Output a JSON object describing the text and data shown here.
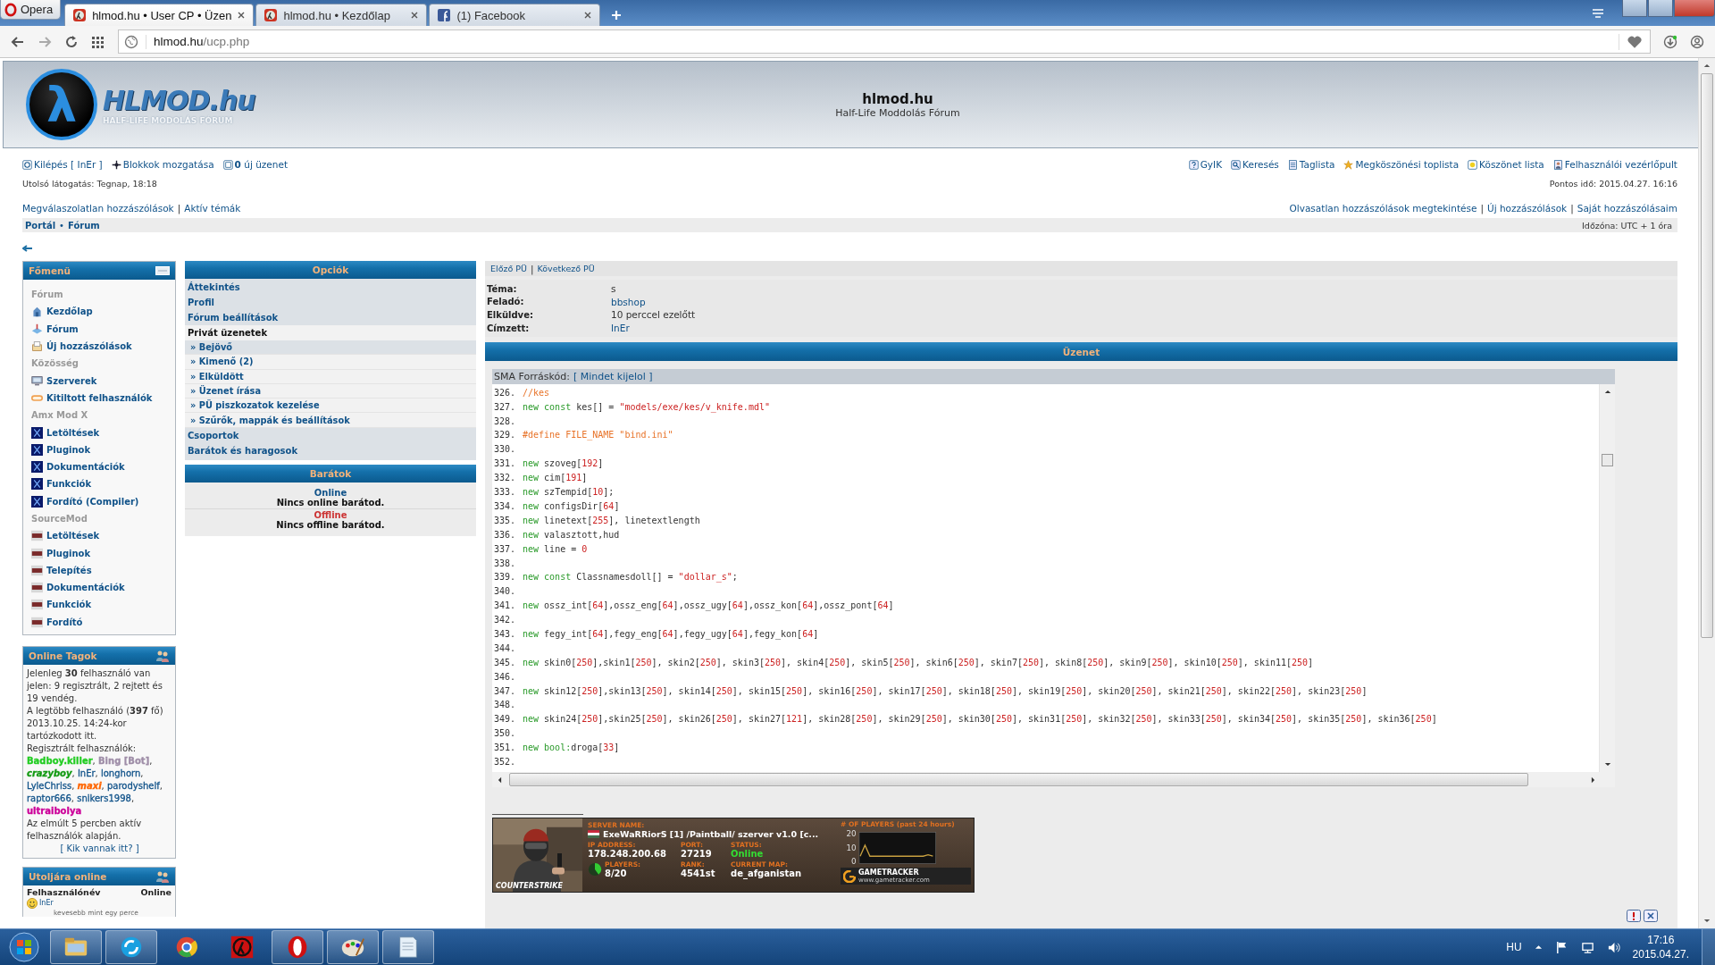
{
  "browser": {
    "opera_label": "Opera",
    "url_host": "hlmod.hu",
    "url_path": "/ucp.php",
    "tabs": [
      {
        "kind": "site",
        "title": "hlmod.hu • User CP • Üzen",
        "selected": true
      },
      {
        "kind": "site",
        "title": "hlmod.hu • Kezdőlap",
        "selected": false
      },
      {
        "kind": "social",
        "title": "(1) Facebook",
        "selected": false
      }
    ]
  },
  "header": {
    "logo_symbol": "λ",
    "logo_name": "HLMOD.hu",
    "logo_tagline": "HALF-LIFE MODOLÁS FÓRUM",
    "title": "hlmod.hu",
    "subtitle": "Half-Life Moddolás Fórum"
  },
  "nav": {
    "left": [
      {
        "kind": "power",
        "text": "Kilépés [ InEr ]"
      },
      {
        "kind": "move",
        "text": "Blokkok mozgatása"
      },
      {
        "kind": "mail",
        "text": "**0** új üzenet"
      }
    ],
    "right": [
      {
        "kind": "help",
        "text": "GyIK"
      },
      {
        "kind": "search",
        "text": "Keresés"
      },
      {
        "kind": "list",
        "text": "Taglista"
      },
      {
        "kind": "star",
        "text": "Megköszönési toplista"
      },
      {
        "kind": "medal",
        "text": "Köszönet lista"
      },
      {
        "kind": "user",
        "text": "Felhasználói vezérlőpult"
      }
    ],
    "last_visit": "Utolsó látogatás: Tegnap, 18:18",
    "current_time": "Pontos idő: 2015.04.27. 16:16",
    "separator": "|",
    "quick_left": [
      "Megválaszolatlan hozzászólások",
      "Aktív témák"
    ],
    "quick_right": [
      "Olvasatlan hozzászólások megtekintése",
      "Új hozzászólások",
      "Saját hozzászólásaim"
    ]
  },
  "breadcrumb": {
    "items": [
      "Portál",
      "Fórum"
    ],
    "separator": "•",
    "timezone": "Időzóna: UTC + 1 óra"
  },
  "main_menu": {
    "title": "Főmenü",
    "items": [
      {
        "kind": "heading",
        "text": "Fórum"
      },
      {
        "kind": "home",
        "text": "Kezdőlap"
      },
      {
        "kind": "forum",
        "text": "Fórum"
      },
      {
        "kind": "posts",
        "text": "Új hozzászólások"
      },
      {
        "kind": "heading",
        "text": "Közösség"
      },
      {
        "kind": "monitor",
        "text": "Szerverek"
      },
      {
        "kind": "newbadge",
        "text": "Kitiltott felhasználók"
      },
      {
        "kind": "heading",
        "text": "Amx Mod X"
      },
      {
        "kind": "amxx",
        "text": "Letöltések"
      },
      {
        "kind": "amxx",
        "text": "Pluginok"
      },
      {
        "kind": "amxx",
        "text": "Dokumentációk"
      },
      {
        "kind": "amxx",
        "text": "Funkciók"
      },
      {
        "kind": "amxx",
        "text": "Fordító (Compiler)"
      },
      {
        "kind": "heading",
        "text": "SourceMod"
      },
      {
        "kind": "sm",
        "text": "Letöltések"
      },
      {
        "kind": "sm",
        "text": "Pluginok"
      },
      {
        "kind": "sm",
        "text": "Telepítés"
      },
      {
        "kind": "sm",
        "text": "Dokumentációk"
      },
      {
        "kind": "sm",
        "text": "Funkciók"
      },
      {
        "kind": "sm",
        "text": "Fordító"
      }
    ]
  },
  "online_members": {
    "title": "Online Tagok",
    "summary": "Jelenleg **30** felhasználó van jelen: 9 regisztrált, 2 rejtett és 19 vendég.",
    "record": "A legtöbb felhasználó (**397** fő) 2013.10.25. 14:24-kor tartózkodott itt.",
    "registered_label": "Regisztrált felhasználók:",
    "users": [
      {
        "name": "Badboy.killer",
        "kind": "bold",
        "color": "#22cc22",
        "sep": ","
      },
      {
        "name": "Bing [Bot]",
        "kind": "bold",
        "color": "#9e8da7",
        "sep": ","
      },
      {
        "name": "crazyboy",
        "kind": "bolditalic",
        "color": "#119911",
        "sep": ","
      },
      {
        "name": "InEr",
        "kind": "plain",
        "color": "#105289",
        "sep": ","
      },
      {
        "name": "longhorn",
        "kind": "plain",
        "color": "#105289",
        "sep": ","
      },
      {
        "name": "LyleChriss",
        "kind": "plain",
        "color": "#105289",
        "sep": ","
      },
      {
        "name": "maxi",
        "kind": "bolditalic",
        "color": "#ff6600",
        "sep": ","
      },
      {
        "name": "parodyshelf",
        "kind": "plain",
        "color": "#105289",
        "sep": ","
      },
      {
        "name": "raptor666",
        "kind": "plain",
        "color": "#105289",
        "sep": ","
      },
      {
        "name": "snikers1998",
        "kind": "plain",
        "color": "#105289",
        "sep": ","
      },
      {
        "name": "ultraibolya",
        "kind": "bold",
        "color": "#cc0099"
      }
    ],
    "footer": "Az elmúlt 5 percben aktív felhasználók alapján.",
    "link": "[ Kik vannak itt? ]"
  },
  "last_online": {
    "title": "Utoljára online",
    "col_name": "Felhasználónév",
    "col_time": "Online",
    "rows": [
      {
        "name": "InEr",
        "time": "kevesebb mint egy perce"
      }
    ]
  },
  "options": {
    "title": "Opciók",
    "bullet": "»",
    "items": [
      {
        "kind": "link",
        "text": "Áttekintés",
        "selected": false
      },
      {
        "kind": "link",
        "text": "Profil",
        "selected": false
      },
      {
        "kind": "link",
        "text": "Fórum beállítások",
        "selected": false
      },
      {
        "kind": "group",
        "text": "Privát üzenetek",
        "selected": false
      },
      {
        "kind": "sub",
        "text": "Bejövő",
        "selected": true
      },
      {
        "kind": "sub",
        "text": "Kimenő (2)",
        "selected": false
      },
      {
        "kind": "sub",
        "text": "Elküldött",
        "selected": false
      },
      {
        "kind": "sub",
        "text": "Üzenet írása",
        "selected": false
      },
      {
        "kind": "sub",
        "text": "PÜ piszkozatok kezelése",
        "selected": false
      },
      {
        "kind": "sub",
        "text": "Szűrők, mappák és beállítások",
        "selected": false
      },
      {
        "kind": "link",
        "text": "Csoportok",
        "selected": false
      },
      {
        "kind": "link",
        "text": "Barátok és haragosok",
        "selected": false
      }
    ]
  },
  "friends": {
    "title": "Barátok",
    "groups": [
      {
        "label": "Online",
        "color": "#105289",
        "text": "Nincs online barátod."
      },
      {
        "label": "Offline",
        "color": "#cc3333",
        "text": "Nincs offline barátod."
      }
    ]
  },
  "message": {
    "prev": "Előző PÜ",
    "separator": "|",
    "next": "Következő PÜ",
    "section_title": "Üzenet",
    "fields": [
      {
        "kind": "text",
        "label": "Téma:",
        "value": "s"
      },
      {
        "kind": "link",
        "label": "Feladó:",
        "value": "bbshop"
      },
      {
        "kind": "text",
        "label": "Elküldve:",
        "value": "10 perccel ezelőtt"
      },
      {
        "kind": "link",
        "label": "Címzett:",
        "value": "InEr"
      }
    ]
  },
  "code": {
    "title": "SMA Forráskód:",
    "select_all": "[ Mindet kijelol ]",
    "lines": [
      {
        "number": "326.",
        "tokens": [
          {
            "kind": "c",
            "text": "//kes"
          }
        ]
      },
      {
        "number": "327.",
        "tokens": [
          {
            "kind": "k",
            "text": "new const "
          },
          {
            "kind": "i",
            "text": "kes[] = "
          },
          {
            "kind": "s",
            "text": "\"models/exe/kes/v_knife.mdl\""
          }
        ]
      },
      {
        "number": "328."
      },
      {
        "number": "329.",
        "tokens": [
          {
            "kind": "c",
            "text": "#define FILE_NAME \"bind.ini\""
          }
        ]
      },
      {
        "number": "330."
      },
      {
        "number": "331.",
        "tokens": [
          {
            "kind": "k",
            "text": "new "
          },
          {
            "kind": "i",
            "text": "szoveg["
          },
          {
            "kind": "n",
            "text": "192"
          },
          {
            "kind": "i",
            "text": "]"
          }
        ]
      },
      {
        "number": "332.",
        "tokens": [
          {
            "kind": "k",
            "text": "new "
          },
          {
            "kind": "i",
            "text": "cim["
          },
          {
            "kind": "n",
            "text": "191"
          },
          {
            "kind": "i",
            "text": "]"
          }
        ]
      },
      {
        "number": "333.",
        "tokens": [
          {
            "kind": "k",
            "text": "new "
          },
          {
            "kind": "i",
            "text": "szTempid["
          },
          {
            "kind": "n",
            "text": "10"
          },
          {
            "kind": "i",
            "text": "];"
          }
        ]
      },
      {
        "number": "334.",
        "tokens": [
          {
            "kind": "k",
            "text": "new "
          },
          {
            "kind": "i",
            "text": "configsDir["
          },
          {
            "kind": "n",
            "text": "64"
          },
          {
            "kind": "i",
            "text": "]"
          }
        ]
      },
      {
        "number": "335.",
        "tokens": [
          {
            "kind": "k",
            "text": "new "
          },
          {
            "kind": "i",
            "text": "linetext["
          },
          {
            "kind": "n",
            "text": "255"
          },
          {
            "kind": "i",
            "text": "], linetextlength"
          }
        ]
      },
      {
        "number": "336.",
        "tokens": [
          {
            "kind": "k",
            "text": "new "
          },
          {
            "kind": "i",
            "text": "valasztott,hud"
          }
        ]
      },
      {
        "number": "337.",
        "tokens": [
          {
            "kind": "k",
            "text": "new "
          },
          {
            "kind": "i",
            "text": "line = "
          },
          {
            "kind": "n",
            "text": "0"
          }
        ]
      },
      {
        "number": "338."
      },
      {
        "number": "339.",
        "tokens": [
          {
            "kind": "k",
            "text": "new const "
          },
          {
            "kind": "i",
            "text": "Classnamesdoll[] = "
          },
          {
            "kind": "s",
            "text": "\"dollar_s\""
          },
          {
            "kind": "i",
            "text": ";"
          }
        ]
      },
      {
        "number": "340."
      },
      {
        "number": "341.",
        "tokens": [
          {
            "kind": "k",
            "text": "new "
          },
          {
            "kind": "i",
            "text": "ossz_int["
          },
          {
            "kind": "n",
            "text": "64"
          },
          {
            "kind": "i",
            "text": "],ossz_eng["
          },
          {
            "kind": "n",
            "text": "64"
          },
          {
            "kind": "i",
            "text": "],ossz_ugy["
          },
          {
            "kind": "n",
            "text": "64"
          },
          {
            "kind": "i",
            "text": "],ossz_kon["
          },
          {
            "kind": "n",
            "text": "64"
          },
          {
            "kind": "i",
            "text": "],ossz_pont["
          },
          {
            "kind": "n",
            "text": "64"
          },
          {
            "kind": "i",
            "text": "]"
          }
        ]
      },
      {
        "number": "342."
      },
      {
        "number": "343.",
        "tokens": [
          {
            "kind": "k",
            "text": "new "
          },
          {
            "kind": "i",
            "text": "fegy_int["
          },
          {
            "kind": "n",
            "text": "64"
          },
          {
            "kind": "i",
            "text": "],fegy_eng["
          },
          {
            "kind": "n",
            "text": "64"
          },
          {
            "kind": "i",
            "text": "],fegy_ugy["
          },
          {
            "kind": "n",
            "text": "64"
          },
          {
            "kind": "i",
            "text": "],fegy_kon["
          },
          {
            "kind": "n",
            "text": "64"
          },
          {
            "kind": "i",
            "text": "]"
          }
        ]
      },
      {
        "number": "344."
      },
      {
        "number": "345.",
        "tokens": [
          {
            "kind": "k",
            "text": "new "
          },
          {
            "kind": "i",
            "text": "skin0["
          },
          {
            "kind": "n",
            "text": "250"
          },
          {
            "kind": "i",
            "text": "],skin1["
          },
          {
            "kind": "n",
            "text": "250"
          },
          {
            "kind": "i",
            "text": "], skin2["
          },
          {
            "kind": "n",
            "text": "250"
          },
          {
            "kind": "i",
            "text": "], skin3["
          },
          {
            "kind": "n",
            "text": "250"
          },
          {
            "kind": "i",
            "text": "], skin4["
          },
          {
            "kind": "n",
            "text": "250"
          },
          {
            "kind": "i",
            "text": "], skin5["
          },
          {
            "kind": "n",
            "text": "250"
          },
          {
            "kind": "i",
            "text": "], skin6["
          },
          {
            "kind": "n",
            "text": "250"
          },
          {
            "kind": "i",
            "text": "], skin7["
          },
          {
            "kind": "n",
            "text": "250"
          },
          {
            "kind": "i",
            "text": "], skin8["
          },
          {
            "kind": "n",
            "text": "250"
          },
          {
            "kind": "i",
            "text": "], skin9["
          },
          {
            "kind": "n",
            "text": "250"
          },
          {
            "kind": "i",
            "text": "], skin10["
          },
          {
            "kind": "n",
            "text": "250"
          },
          {
            "kind": "i",
            "text": "], skin11["
          },
          {
            "kind": "n",
            "text": "250"
          },
          {
            "kind": "i",
            "text": "]"
          }
        ]
      },
      {
        "number": "346."
      },
      {
        "number": "347.",
        "tokens": [
          {
            "kind": "k",
            "text": "new "
          },
          {
            "kind": "i",
            "text": "skin12["
          },
          {
            "kind": "n",
            "text": "250"
          },
          {
            "kind": "i",
            "text": "],skin13["
          },
          {
            "kind": "n",
            "text": "250"
          },
          {
            "kind": "i",
            "text": "], skin14["
          },
          {
            "kind": "n",
            "text": "250"
          },
          {
            "kind": "i",
            "text": "], skin15["
          },
          {
            "kind": "n",
            "text": "250"
          },
          {
            "kind": "i",
            "text": "], skin16["
          },
          {
            "kind": "n",
            "text": "250"
          },
          {
            "kind": "i",
            "text": "], skin17["
          },
          {
            "kind": "n",
            "text": "250"
          },
          {
            "kind": "i",
            "text": "], skin18["
          },
          {
            "kind": "n",
            "text": "250"
          },
          {
            "kind": "i",
            "text": "], skin19["
          },
          {
            "kind": "n",
            "text": "250"
          },
          {
            "kind": "i",
            "text": "], skin20["
          },
          {
            "kind": "n",
            "text": "250"
          },
          {
            "kind": "i",
            "text": "], skin21["
          },
          {
            "kind": "n",
            "text": "250"
          },
          {
            "kind": "i",
            "text": "], skin22["
          },
          {
            "kind": "n",
            "text": "250"
          },
          {
            "kind": "i",
            "text": "], skin23["
          },
          {
            "kind": "n",
            "text": "250"
          },
          {
            "kind": "i",
            "text": "]"
          }
        ]
      },
      {
        "number": "348."
      },
      {
        "number": "349.",
        "tokens": [
          {
            "kind": "k",
            "text": "new "
          },
          {
            "kind": "i",
            "text": "skin24["
          },
          {
            "kind": "n",
            "text": "250"
          },
          {
            "kind": "i",
            "text": "],skin25["
          },
          {
            "kind": "n",
            "text": "250"
          },
          {
            "kind": "i",
            "text": "], skin26["
          },
          {
            "kind": "n",
            "text": "250"
          },
          {
            "kind": "i",
            "text": "], skin27["
          },
          {
            "kind": "n",
            "text": "121"
          },
          {
            "kind": "i",
            "text": "], skin28["
          },
          {
            "kind": "n",
            "text": "250"
          },
          {
            "kind": "i",
            "text": "], skin29["
          },
          {
            "kind": "n",
            "text": "250"
          },
          {
            "kind": "i",
            "text": "], skin30["
          },
          {
            "kind": "n",
            "text": "250"
          },
          {
            "kind": "i",
            "text": "], skin31["
          },
          {
            "kind": "n",
            "text": "250"
          },
          {
            "kind": "i",
            "text": "], skin32["
          },
          {
            "kind": "n",
            "text": "250"
          },
          {
            "kind": "i",
            "text": "], skin33["
          },
          {
            "kind": "n",
            "text": "250"
          },
          {
            "kind": "i",
            "text": "], skin34["
          },
          {
            "kind": "n",
            "text": "250"
          },
          {
            "kind": "i",
            "text": "], skin35["
          },
          {
            "kind": "n",
            "text": "250"
          },
          {
            "kind": "i",
            "text": "], skin36["
          },
          {
            "kind": "n",
            "text": "250"
          },
          {
            "kind": "i",
            "text": "]"
          }
        ]
      },
      {
        "number": "350."
      },
      {
        "number": "351.",
        "tokens": [
          {
            "kind": "k",
            "text": "new bool:"
          },
          {
            "kind": "i",
            "text": "droga["
          },
          {
            "kind": "n",
            "text": "33"
          },
          {
            "kind": "i",
            "text": "]"
          }
        ]
      },
      {
        "number": "352."
      }
    ]
  },
  "banner": {
    "game_logo": "COUNTERSTRIKE",
    "server_name_label": "SERVER NAME:",
    "server_name": "ExeWaRRiorS [1] /Paintball/ szerver v1.0 [c...",
    "ip_label": "IP ADDRESS:",
    "ip": "178.248.200.68",
    "port_label": "PORT:",
    "port": "27219",
    "status_label": "STATUS:",
    "status": "Online",
    "players_label": "PLAYERS:",
    "players": "8/20",
    "level": 0.4,
    "rank_label": "RANK:",
    "rank": "4541st",
    "map_label": "CURRENT MAP:",
    "map": "de_afganistan",
    "tracker_name": "GAMETRACKER",
    "tracker_url": "www.gametracker.com",
    "chart_data": {
      "type": "line",
      "title": "# OF PLAYERS (past 24 hours)",
      "ylim": [
        0,
        20
      ],
      "yticks": [
        0,
        10,
        20
      ],
      "series": [
        {
          "color": "#c8a040",
          "values": [
            4,
            12,
            4,
            4,
            4,
            4,
            4,
            4,
            4,
            4,
            4,
            4,
            4,
            4,
            5,
            4
          ]
        }
      ]
    }
  },
  "taskbar": {
    "apps": [
      {
        "kind": "folder",
        "running": true
      },
      {
        "kind": "skype",
        "running": true
      },
      {
        "kind": "chrome",
        "running": false
      },
      {
        "kind": "halflife",
        "running": false
      },
      {
        "kind": "opera",
        "running": true
      },
      {
        "kind": "paint",
        "running": true
      },
      {
        "kind": "notepad",
        "running": true
      }
    ],
    "lang": "HU",
    "time": "17:16",
    "date": "2015.04.27."
  }
}
